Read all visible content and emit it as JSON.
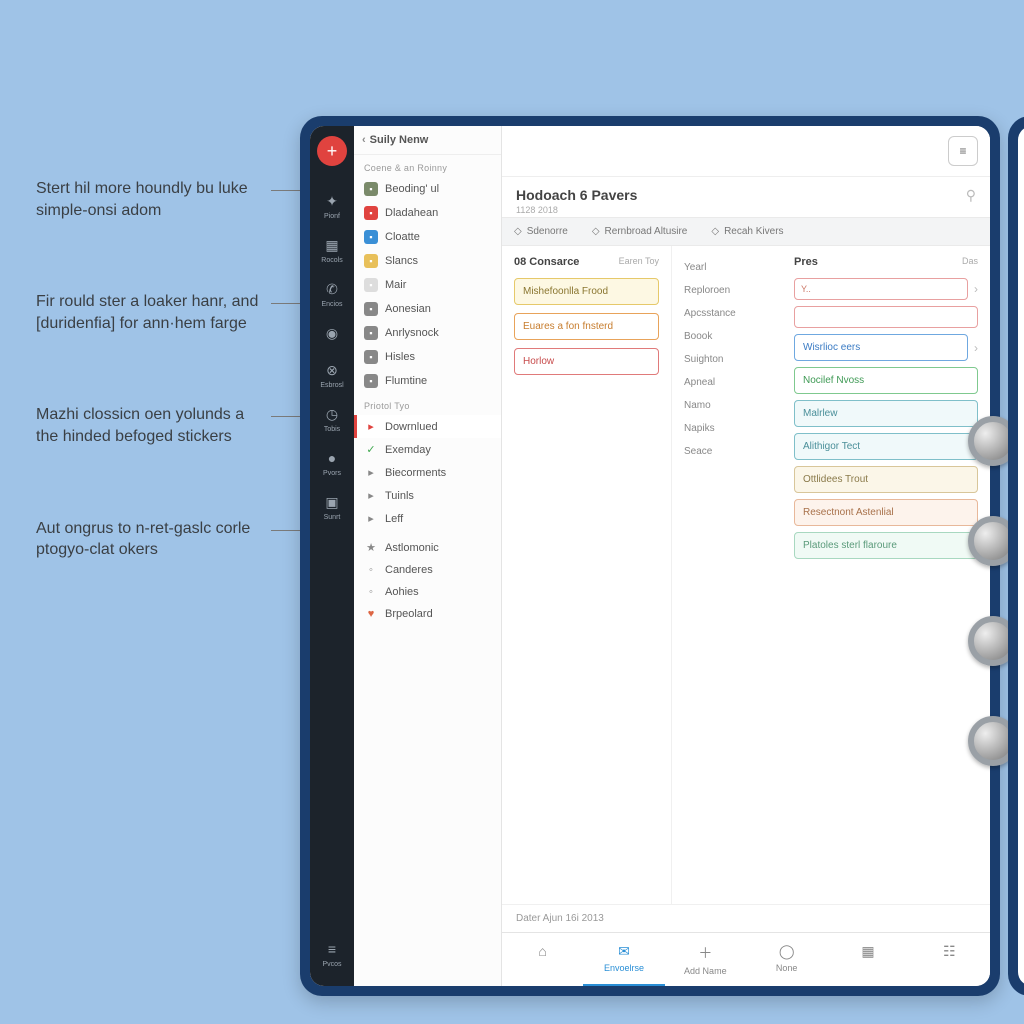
{
  "callouts": [
    "Stert hil more houndly bu luke simple-onsi adom",
    "Fir rould ster a loaker hanr, and [duridenfia] for ann·hem farge",
    "Mazhi clossicn oen yolunds a the hinded befoged stickers",
    "Aut ongrus to n-ret-gaslc corle ptogyo-clat okers"
  ],
  "rail": {
    "items": [
      {
        "label": "Pionf"
      },
      {
        "label": "Rocols"
      },
      {
        "label": "Encios"
      },
      {
        "label": ""
      },
      {
        "label": "Esbrosl"
      },
      {
        "label": "Tobis"
      },
      {
        "label": "Pvors"
      },
      {
        "label": "Sunrt"
      }
    ],
    "bottom": {
      "label": "Pvcos"
    }
  },
  "listpanel": {
    "back": "‹",
    "title": "Suily Nenw",
    "section1": "Coene & an Roinny",
    "items1": [
      {
        "label": "Beoding' ul",
        "color": "#7a8a6a"
      },
      {
        "label": "Dladahean",
        "color": "#e0433f"
      },
      {
        "label": "Cloatte",
        "color": "#3a8fd6"
      },
      {
        "label": "Slancs",
        "color": "#e8c05a"
      },
      {
        "label": "Mair",
        "color": "#ddd"
      },
      {
        "label": "Aonesian",
        "color": "#888"
      },
      {
        "label": "Anrlysnock",
        "color": "#888"
      },
      {
        "label": "Hisles",
        "color": "#888"
      },
      {
        "label": "Flumtine",
        "color": "#888"
      }
    ],
    "section2": "Priotol Tyo",
    "items2": [
      {
        "label": "Dowrnlued",
        "active": true
      },
      {
        "label": "Exemday",
        "check": true
      },
      {
        "label": "Biecorments"
      },
      {
        "label": "Tuinls"
      },
      {
        "label": "Leff"
      }
    ],
    "items3": [
      {
        "label": "Astlomonic",
        "star": true
      },
      {
        "label": "Canderes"
      },
      {
        "label": "Aohies"
      },
      {
        "label": "Brpeolard",
        "heart": true
      }
    ]
  },
  "main": {
    "title": "Hodoach 6 Pavers",
    "date_small": "1128 2018",
    "tabs": [
      "Sdenorre",
      "Rernbroad Altusire",
      "Recah Kivers"
    ],
    "colA": {
      "head": "08 Consarce",
      "head_right": "Earen Toy",
      "cards": [
        {
          "text": "Mishefoonlla Frood",
          "cls": "c-yellow"
        },
        {
          "text": "Euares a fon fnsterd",
          "cls": "c-orange"
        },
        {
          "text": "Horlow",
          "cls": "c-red"
        }
      ]
    },
    "colB": {
      "labels": [
        "Yearl",
        "Reploroen",
        "Apcsstance",
        "Boook",
        "Suighton",
        "Apneal",
        "Namo",
        "Napiks",
        "Seace"
      ]
    },
    "colC": {
      "head": "Pres",
      "head_right": "Das",
      "rows": [
        {
          "type": "box",
          "text": "Y..",
          "cls": "c-red",
          "chev": true
        },
        {
          "type": "box",
          "text": "",
          "cls": "c-red"
        },
        {
          "type": "card",
          "text": "Wisrlioc eers",
          "cls": "c-blue",
          "chev": true
        },
        {
          "type": "card",
          "text": "Nocilef Nvoss",
          "cls": "c-green"
        },
        {
          "type": "card",
          "text": "Malrlew",
          "cls": "c-teal"
        },
        {
          "type": "card",
          "text": "Alithigor Tect",
          "cls": "c-teal"
        },
        {
          "type": "card",
          "text": "Ottlidees Trout",
          "cls": "c-tan"
        },
        {
          "type": "card",
          "text": "Resectnont Astenlial",
          "cls": "c-peach"
        },
        {
          "type": "card",
          "text": "Platoles sterl flaroure",
          "cls": "c-mint"
        }
      ]
    },
    "footer_date": "Dater Ajun 16i 2013",
    "bottom_nav": [
      {
        "label": ""
      },
      {
        "label": "Envoelrse",
        "active": true
      },
      {
        "label": "Add Name"
      },
      {
        "label": "None"
      },
      {
        "label": ""
      },
      {
        "label": ""
      }
    ]
  }
}
